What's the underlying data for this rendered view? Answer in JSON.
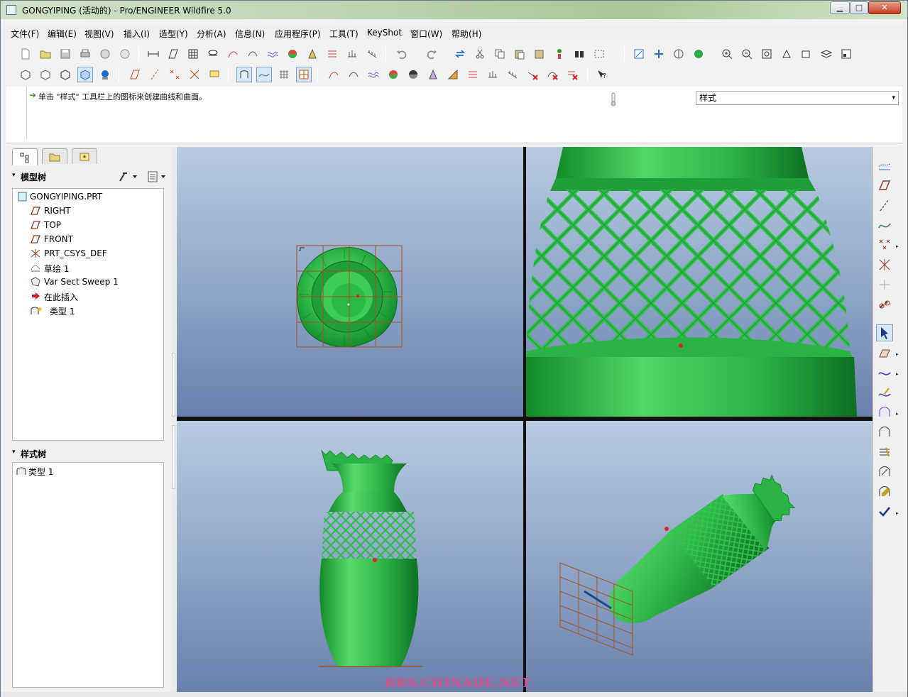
{
  "window": {
    "title": "GONGYIPING (活动的) - Pro/ENGINEER Wildfire 5.0",
    "minimize": "▁",
    "maximize": "□",
    "close": "✕"
  },
  "menu": [
    "文件(F)",
    "编辑(E)",
    "视图(V)",
    "插入(I)",
    "造型(Y)",
    "分析(A)",
    "信息(N)",
    "应用程序(P)",
    "工具(T)",
    "KeyShot",
    "窗口(W)",
    "帮助(H)"
  ],
  "message": {
    "arrow": "➔",
    "text": "单击 \"样式\" 工具栏上的图标来创建曲线和曲面。"
  },
  "style_select": {
    "value": "样式",
    "arrow": "▾"
  },
  "sidebar": {
    "model_tree_title": "模型树",
    "style_tree_title": "样式树",
    "caret": "▾",
    "model_tree": [
      {
        "label": "GONGYIPING.PRT",
        "icon": "part-icon"
      },
      {
        "label": "RIGHT",
        "icon": "datum-plane-icon"
      },
      {
        "label": "TOP",
        "icon": "datum-plane-icon"
      },
      {
        "label": "FRONT",
        "icon": "datum-plane-icon"
      },
      {
        "label": "PRT_CSYS_DEF",
        "icon": "csys-icon"
      },
      {
        "label": "草绘 1",
        "icon": "sketch-icon"
      },
      {
        "label": "Var Sect Sweep 1",
        "icon": "sweep-icon"
      },
      {
        "label": "在此插入",
        "icon": "insert-here-icon"
      },
      {
        "label": "类型 1",
        "icon": "style-feature-icon"
      }
    ],
    "style_tree": [
      {
        "label": "类型 1",
        "icon": "style-feature-icon"
      }
    ]
  },
  "watermark": "BBS.CHINADE.NET",
  "colors": {
    "model_green": "#2fc24a",
    "model_dark": "#147a28",
    "viewport_top": "#b8cbe0",
    "viewport_bottom": "#6a7faa"
  }
}
